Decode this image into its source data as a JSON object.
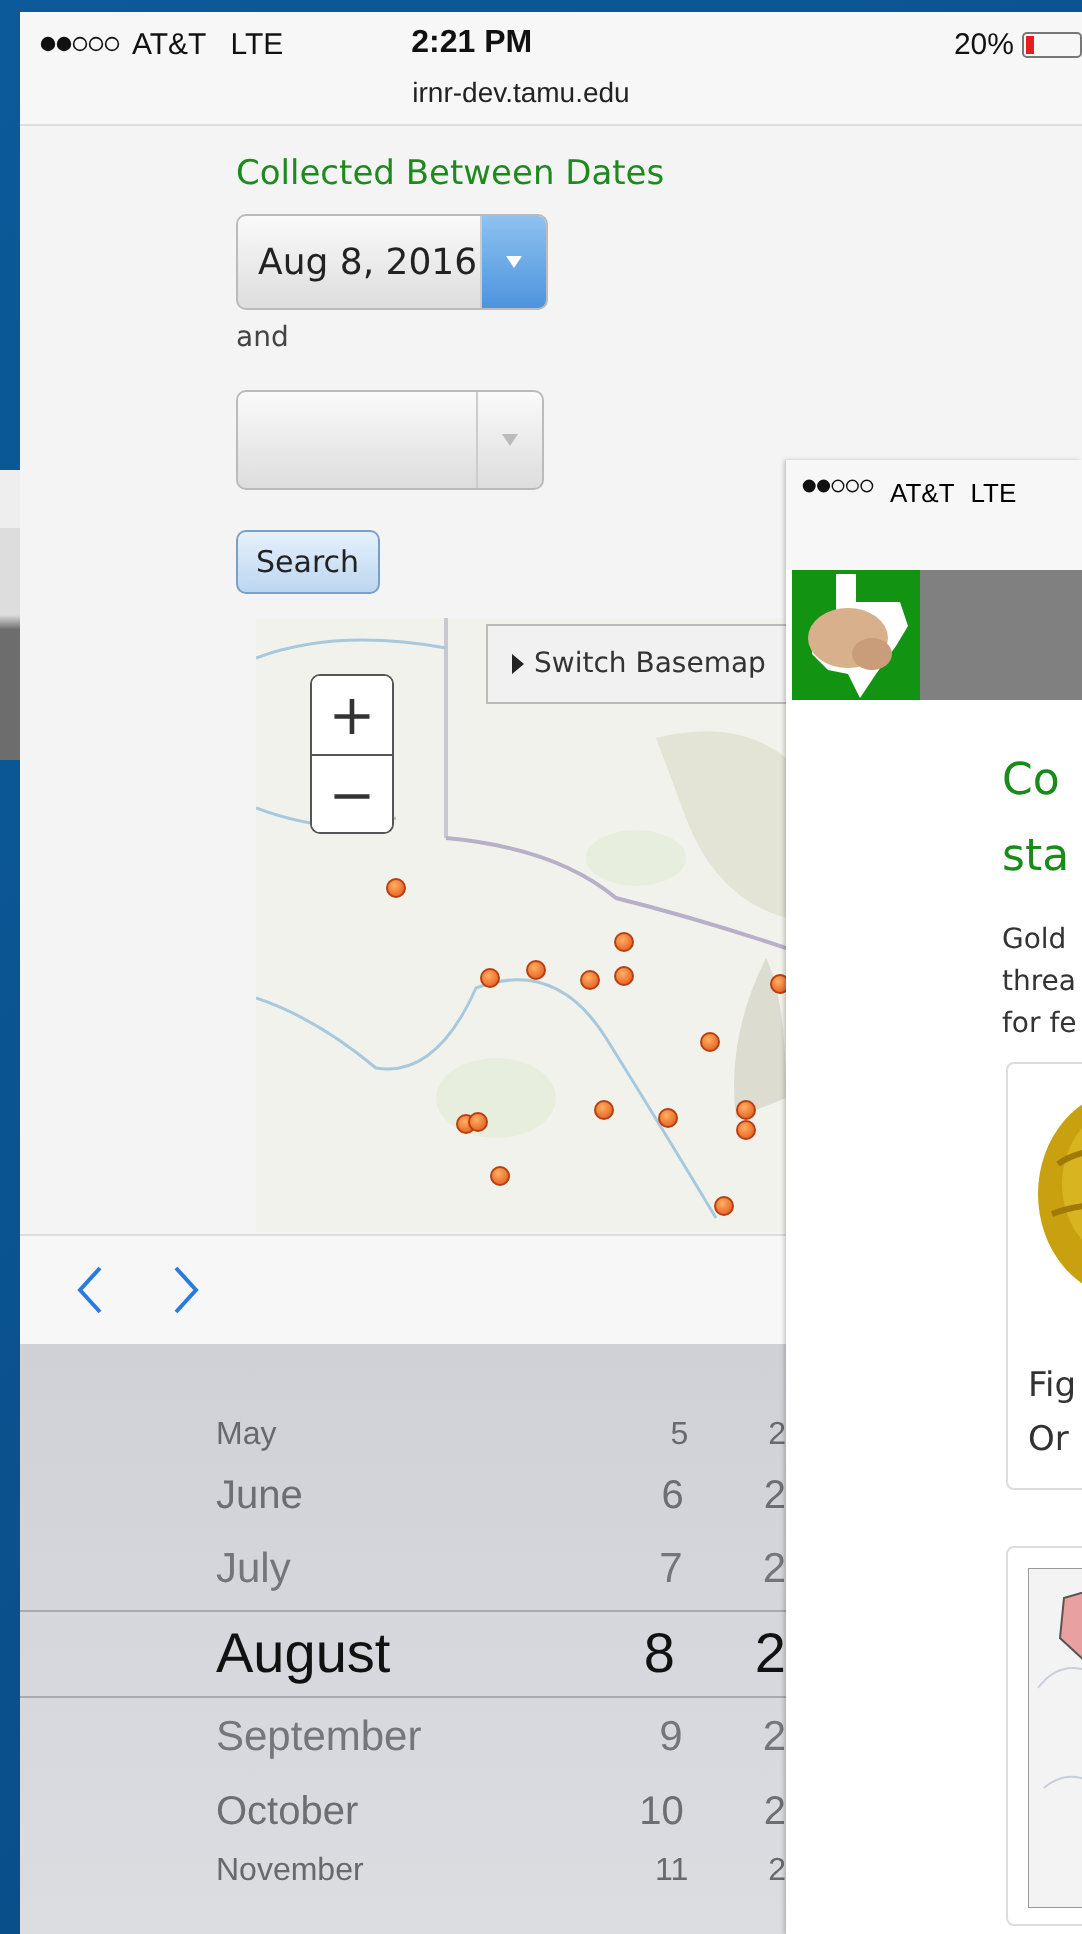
{
  "main_screen": {
    "status_bar": {
      "carrier": "AT&T",
      "network": "LTE",
      "time": "2:21 PM",
      "battery": "20%"
    },
    "url": "irnr-dev.tamu.edu",
    "form": {
      "heading": "Collected Between Dates",
      "start_date": {
        "value": "Aug 8, 2016"
      },
      "conjunction": "and",
      "search_button": "Search"
    },
    "map": {
      "zoom_in": "+",
      "zoom_out": "−",
      "basemap_button": "Switch Basemap"
    },
    "picker": {
      "rows": [
        {
          "month": "May",
          "day": "5",
          "year": "2",
          "selected": false
        },
        {
          "month": "June",
          "day": "6",
          "year": "2",
          "selected": false
        },
        {
          "month": "July",
          "day": "7",
          "year": "2",
          "selected": false
        },
        {
          "month": "August",
          "day": "8",
          "year": "2",
          "selected": true
        },
        {
          "month": "September",
          "day": "9",
          "year": "2",
          "selected": false
        },
        {
          "month": "October",
          "day": "10",
          "year": "2",
          "selected": false
        },
        {
          "month": "November",
          "day": "11",
          "year": "2",
          "selected": false
        }
      ]
    }
  },
  "overlay_screen": {
    "status_bar": {
      "carrier": "AT&T",
      "network": "LTE"
    },
    "title_lines": [
      "Co",
      "sta"
    ],
    "intro_lines": [
      "Gold",
      "threa",
      "for fe"
    ],
    "caption_lines": [
      "Fig",
      "Or"
    ]
  }
}
